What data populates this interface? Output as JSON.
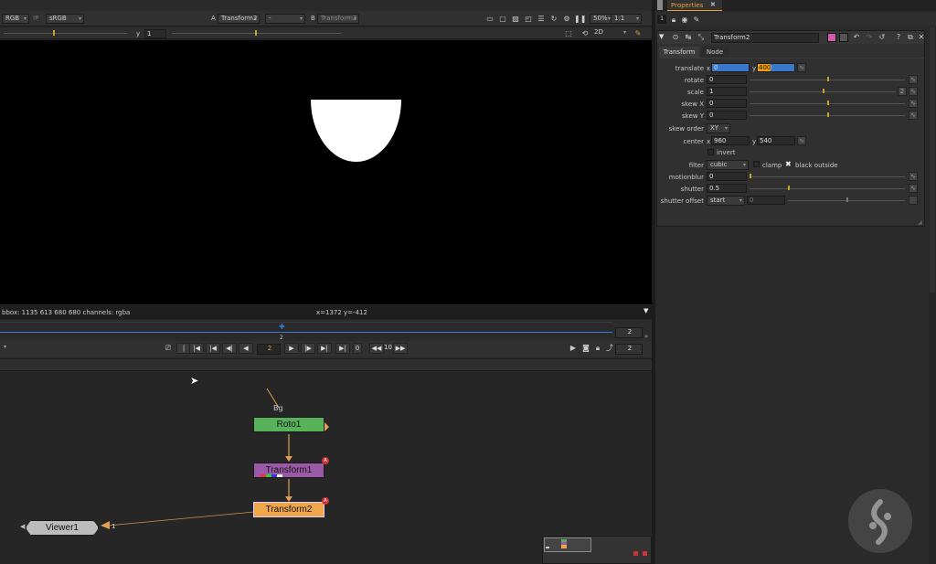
{
  "viewer_toolbar": {
    "channels": "RGB",
    "ip": "IP",
    "colorspace": "sRGB",
    "input_a_label": "A",
    "input_a": "Transform2",
    "composite": "-",
    "input_b_label": "B",
    "input_b": "Transform2",
    "zoom": "50%",
    "ratio": "1:1",
    "y_label": "y",
    "y_value": "1",
    "view_mode": "2D"
  },
  "viewer": {
    "bbox_info": "bbox: 1135 613 680 680 channels: rgba",
    "cursor_info": "x=1372 y=-412"
  },
  "timeline": {
    "current_frame": "2",
    "frame_field": "2",
    "end_frame": "2",
    "increment": "10",
    "range_end": "2"
  },
  "properties": {
    "tab_title": "Properties",
    "node_name": "Transform2",
    "tabs": [
      "Transform",
      "Node"
    ],
    "translate": {
      "label": "translate",
      "x_label": "x",
      "x_value": "0",
      "y_label": "y",
      "y_value": "400"
    },
    "rotate": {
      "label": "rotate",
      "value": "0"
    },
    "scale": {
      "label": "scale",
      "value": "1"
    },
    "skew_x": {
      "label": "skew X",
      "value": "0"
    },
    "skew_y": {
      "label": "skew Y",
      "value": "0"
    },
    "skew_order": {
      "label": "skew order",
      "value": "XY"
    },
    "center": {
      "label": "center",
      "x_label": "x",
      "x_value": "960",
      "y_label": "y",
      "y_value": "540"
    },
    "invert": {
      "label": "invert",
      "checked": false
    },
    "filter": {
      "label": "filter",
      "value": "cubic",
      "clamp_label": "clamp",
      "clamp_checked": false,
      "black_outside_label": "black outside",
      "black_outside_checked": true
    },
    "motionblur": {
      "label": "motionblur",
      "value": "0"
    },
    "shutter": {
      "label": "shutter",
      "value": "0.5"
    },
    "shutter_offset": {
      "label": "shutter offset",
      "value": "start",
      "custom": "0"
    }
  },
  "node_graph": {
    "bg_label": "Bg",
    "nodes": [
      {
        "name": "Roto1",
        "color": "#57b25a"
      },
      {
        "name": "Transform1",
        "color": "#9b5aa8"
      },
      {
        "name": "Transform2",
        "color": "#f0a64a"
      },
      {
        "name": "Viewer1",
        "color": "#bcbcbc"
      }
    ],
    "viewer_input": "1",
    "badge": "A"
  },
  "colors": {
    "accent": "#e8a13c",
    "selection": "#3b78c9",
    "highlight": "#f0a000"
  }
}
